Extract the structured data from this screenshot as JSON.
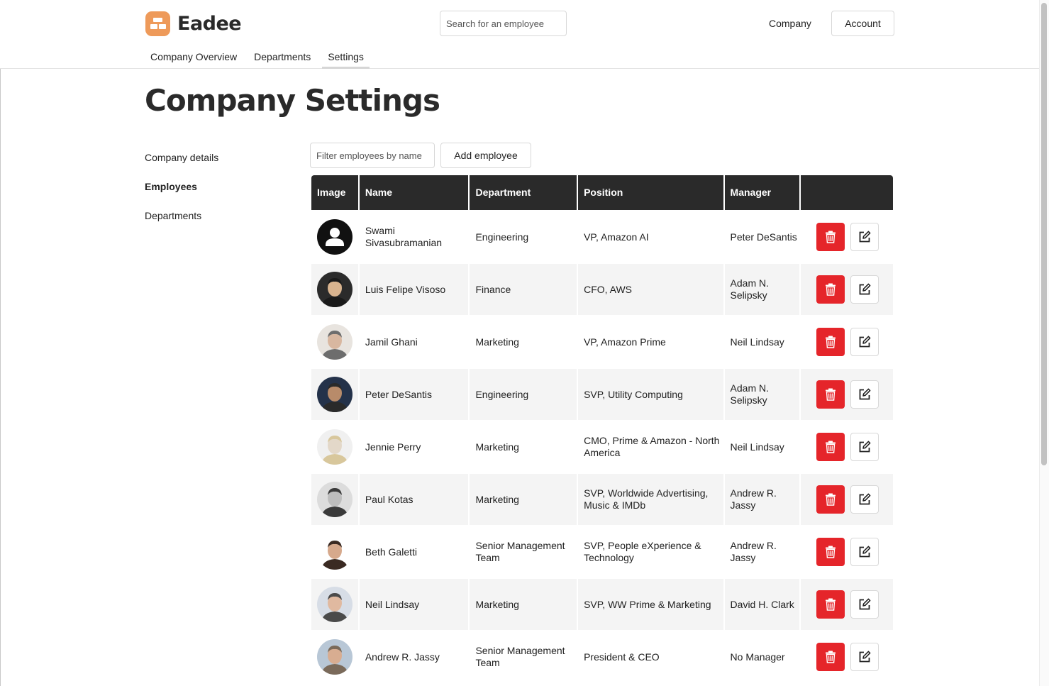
{
  "brand": {
    "name": "Eadee",
    "accent": "#ee9a5a"
  },
  "header": {
    "search_placeholder": "Search for an employee",
    "company_link": "Company",
    "account_button": "Account"
  },
  "tabs": [
    {
      "label": "Company Overview",
      "active": false
    },
    {
      "label": "Departments",
      "active": false
    },
    {
      "label": "Settings",
      "active": true
    }
  ],
  "page": {
    "title": "Company Settings"
  },
  "sidenav": [
    {
      "label": "Company details",
      "active": false
    },
    {
      "label": "Employees",
      "active": true
    },
    {
      "label": "Departments",
      "active": false
    }
  ],
  "toolbar": {
    "filter_placeholder": "Filter employees by name",
    "add_button": "Add employee"
  },
  "table": {
    "columns": [
      "Image",
      "Name",
      "Department",
      "Position",
      "Manager",
      ""
    ],
    "rows": [
      {
        "name": "Swami Sivasubramanian",
        "department": "Engineering",
        "position": "VP, Amazon AI",
        "manager": "Peter DeSantis",
        "avatar": "placeholder"
      },
      {
        "name": "Luis Felipe Visoso",
        "department": "Finance",
        "position": "CFO, AWS",
        "manager": "Adam N. Selipsky",
        "avatar": "photo"
      },
      {
        "name": "Jamil Ghani",
        "department": "Marketing",
        "position": "VP, Amazon Prime",
        "manager": "Neil Lindsay",
        "avatar": "photo"
      },
      {
        "name": "Peter DeSantis",
        "department": "Engineering",
        "position": "SVP, Utility Computing",
        "manager": "Adam N. Selipsky",
        "avatar": "photo"
      },
      {
        "name": "Jennie Perry",
        "department": "Marketing",
        "position": "CMO, Prime & Amazon - North America",
        "manager": "Neil Lindsay",
        "avatar": "photo"
      },
      {
        "name": "Paul Kotas",
        "department": "Marketing",
        "position": "SVP, Worldwide Advertising, Music & IMDb",
        "manager": "Andrew R. Jassy",
        "avatar": "photo"
      },
      {
        "name": "Beth Galetti",
        "department": "Senior Management Team",
        "position": "SVP, People eXperience & Technology",
        "manager": "Andrew R. Jassy",
        "avatar": "photo"
      },
      {
        "name": "Neil Lindsay",
        "department": "Marketing",
        "position": "SVP, WW Prime & Marketing",
        "manager": "David H. Clark",
        "avatar": "photo"
      },
      {
        "name": "Andrew R. Jassy",
        "department": "Senior Management Team",
        "position": "President & CEO",
        "manager": "No Manager",
        "avatar": "photo"
      }
    ]
  },
  "colors": {
    "delete": "#e5252a",
    "header_bg": "#2a2a2a",
    "row_alt": "#f4f4f4"
  }
}
